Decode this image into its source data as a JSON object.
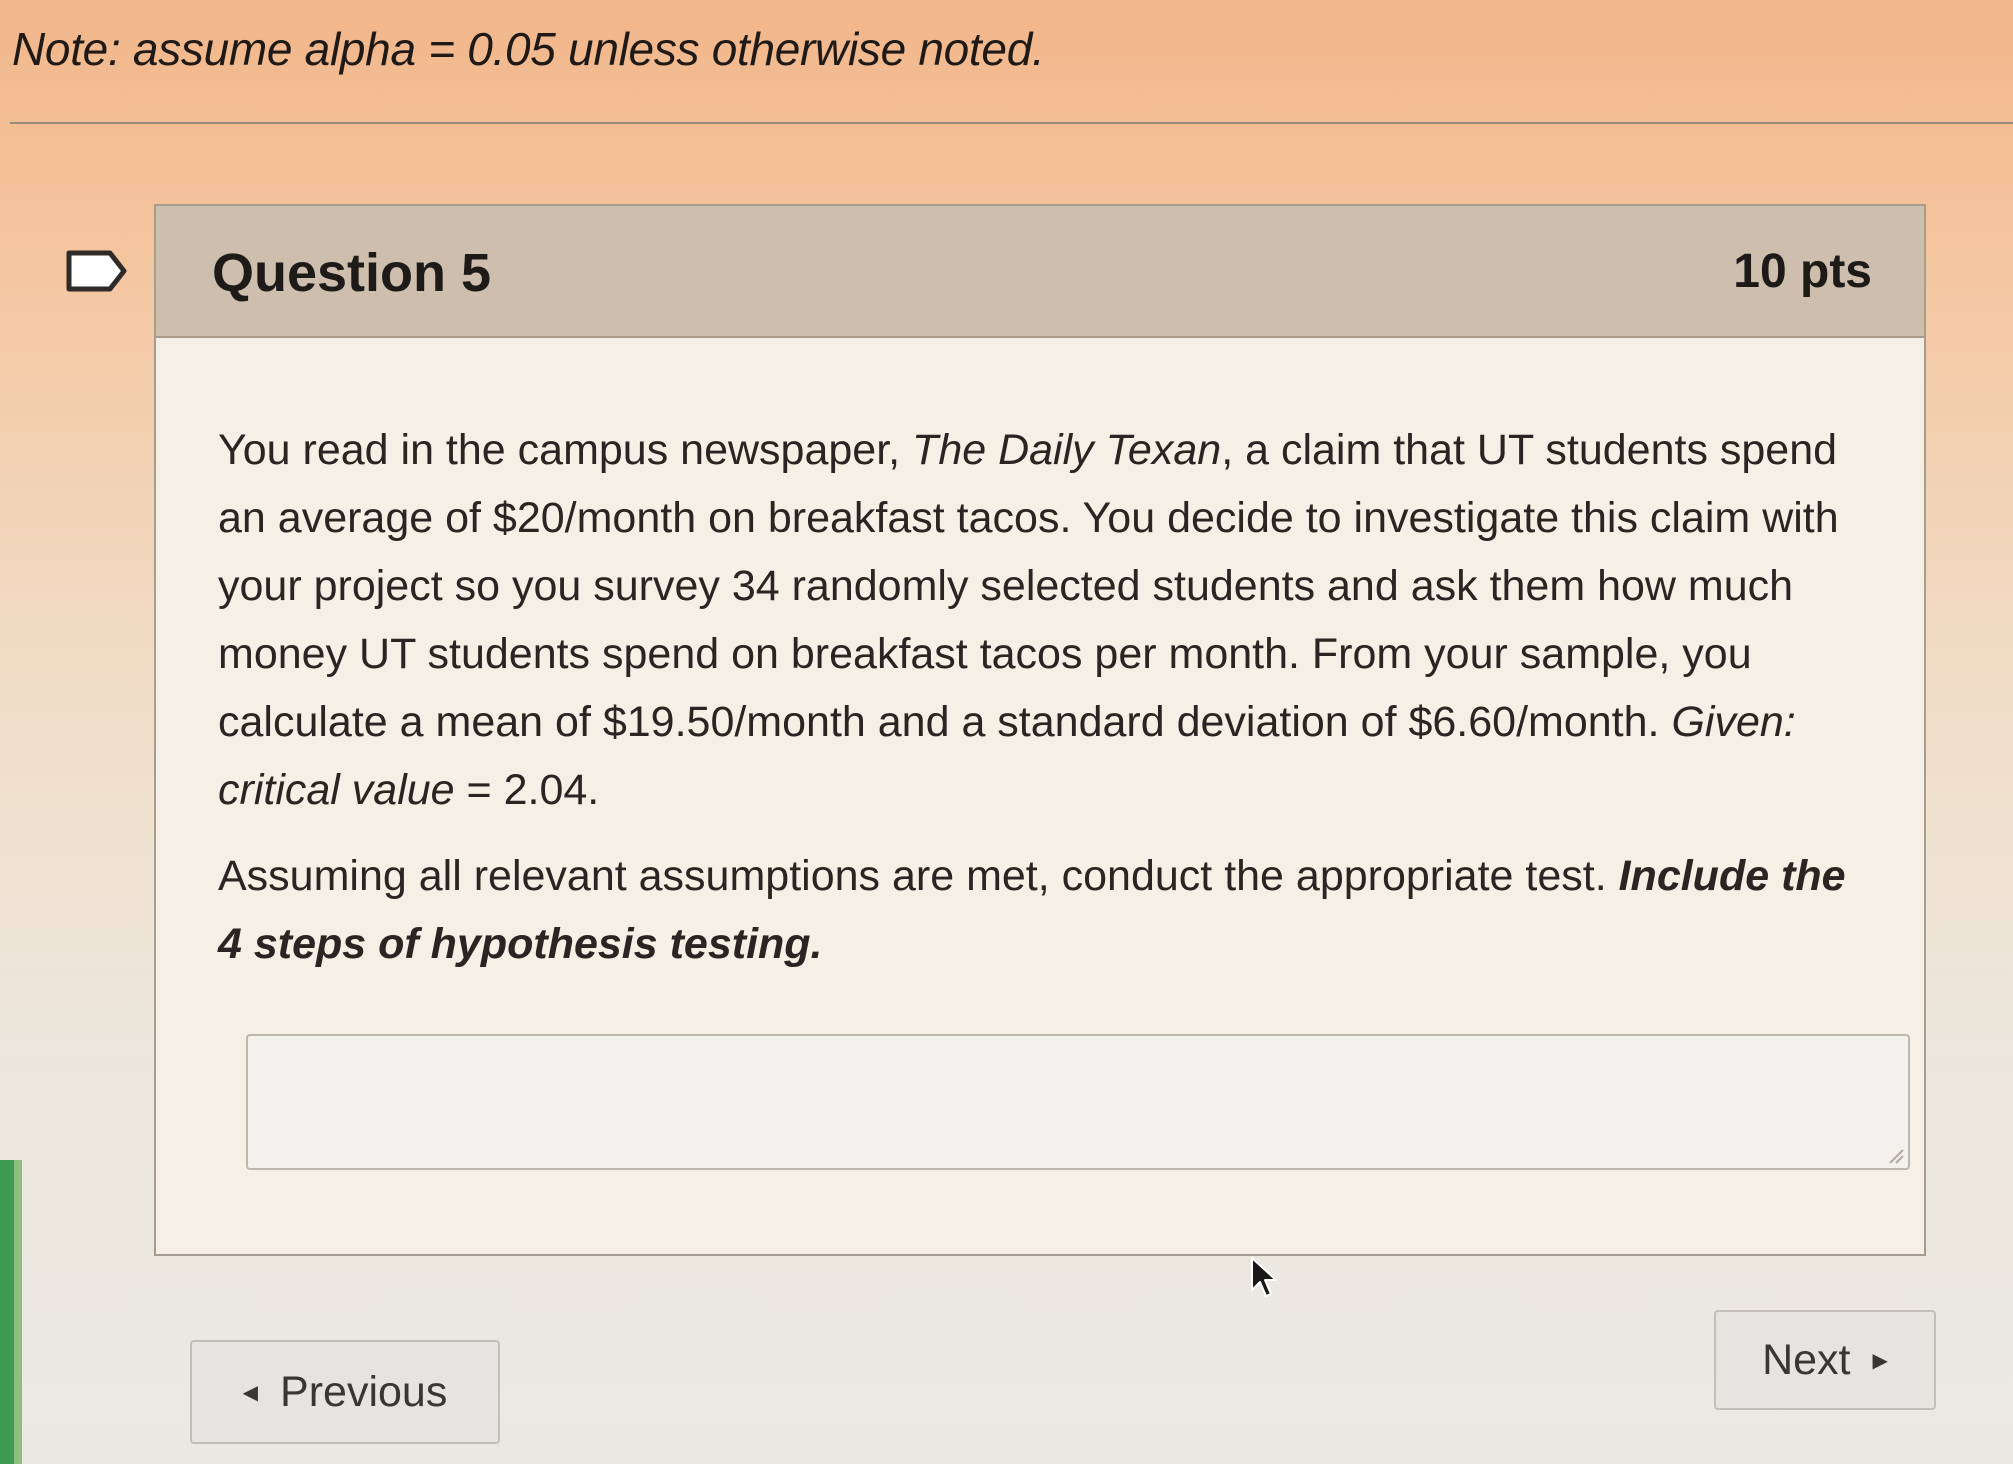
{
  "note": {
    "text": "Note: assume alpha = 0.05 unless otherwise noted."
  },
  "question": {
    "title": "Question 5",
    "points": "10 pts",
    "paragraph1": {
      "part1": "You read in the campus newspaper, ",
      "newspaper": "The Daily Texan",
      "part2": ", a claim that UT students spend an average of $20/month on breakfast tacos. You decide to investigate this claim with your project so you survey 34 randomly selected students and ask them how much money UT students spend on breakfast tacos per month. From your sample, you calculate a mean of $19.50/month and a standard deviation of $6.60/month. ",
      "given": "Given: critical value",
      "given_value": " = 2.04."
    },
    "paragraph2": {
      "part1": "Assuming all relevant assumptions are met, conduct the appropriate test. ",
      "emphasis": "Include the 4 steps of hypothesis testing."
    },
    "answer": {
      "value": "",
      "placeholder": ""
    }
  },
  "nav": {
    "previous_label": "Previous",
    "next_label": "Next"
  },
  "icons": {
    "flag": "flag-outline-icon",
    "resize": "resize-handle-icon",
    "cursor": "mouse-pointer-icon",
    "prev_arrow": "triangle-left-icon",
    "next_arrow": "triangle-right-icon"
  }
}
